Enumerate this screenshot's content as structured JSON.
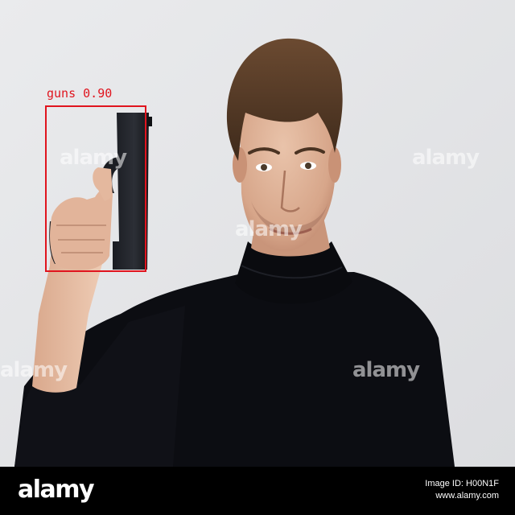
{
  "image": {
    "description_icon": "photo-of-man-holding-pistol",
    "background_color": "#e4e5e7",
    "sweater_color": "#0c0d12"
  },
  "detection": {
    "label": "guns",
    "score": "0.90",
    "color": "#e0141e"
  },
  "watermark_text": "alamy",
  "footer": {
    "logo": "alamy",
    "image_id": "Image ID: H00N1F",
    "site": "www.alamy.com",
    "background": "#000000"
  }
}
